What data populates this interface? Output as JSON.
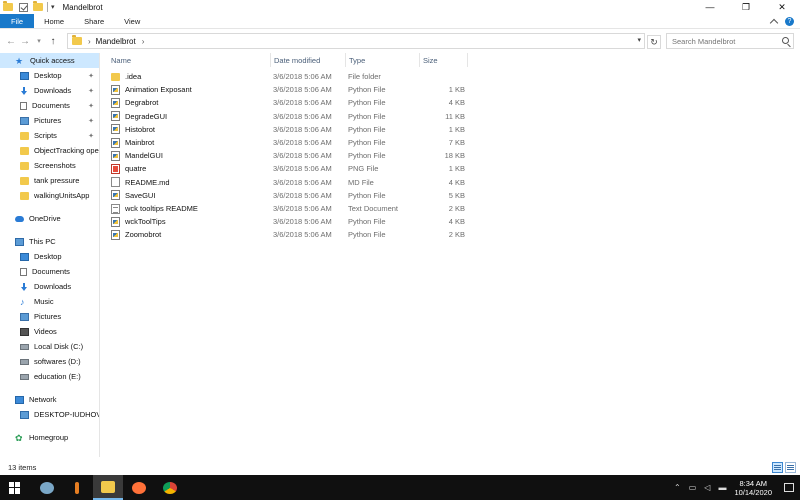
{
  "window": {
    "title": "Mandelbrot",
    "controls": {
      "minimize": "—",
      "maximize": "❐",
      "close": "✕"
    }
  },
  "ribbon": {
    "tabs": [
      "File",
      "Home",
      "Share",
      "View"
    ],
    "help": "?"
  },
  "address_bar": {
    "path": "Mandelbrot",
    "search_placeholder": "Search Mandelbrot"
  },
  "sidebar": {
    "quick_access": {
      "label": "Quick access",
      "items": [
        {
          "label": "Desktop",
          "icon": "desktop-icon",
          "pinned": true
        },
        {
          "label": "Downloads",
          "icon": "download-icon",
          "pinned": true
        },
        {
          "label": "Documents",
          "icon": "documents-icon",
          "pinned": true
        },
        {
          "label": "Pictures",
          "icon": "pictures-icon",
          "pinned": true
        },
        {
          "label": "Scripts",
          "icon": "folder-icon",
          "pinned": true
        },
        {
          "label": "ObjectTracking ope",
          "icon": "folder-icon",
          "pinned": false
        },
        {
          "label": "Screenshots",
          "icon": "folder-icon",
          "pinned": false
        },
        {
          "label": "tank pressure",
          "icon": "folder-icon",
          "pinned": false
        },
        {
          "label": "walkingUnitsApp",
          "icon": "folder-icon",
          "pinned": false
        }
      ]
    },
    "onedrive": "OneDrive",
    "this_pc": {
      "label": "This PC",
      "items": [
        {
          "label": "Desktop",
          "icon": "desktop-icon"
        },
        {
          "label": "Documents",
          "icon": "documents-icon"
        },
        {
          "label": "Downloads",
          "icon": "download-icon"
        },
        {
          "label": "Music",
          "icon": "music-icon"
        },
        {
          "label": "Pictures",
          "icon": "pictures-icon"
        },
        {
          "label": "Videos",
          "icon": "videos-icon"
        },
        {
          "label": "Local Disk (C:)",
          "icon": "disk-icon"
        },
        {
          "label": "softwares (D:)",
          "icon": "disk-icon"
        },
        {
          "label": "education (E:)",
          "icon": "disk-icon"
        }
      ]
    },
    "network": {
      "label": "Network",
      "items": [
        {
          "label": "DESKTOP-IUDHOVL",
          "icon": "computer-icon"
        }
      ]
    },
    "homegroup": "Homegroup"
  },
  "file_list": {
    "columns": [
      "Name",
      "Date modified",
      "Type",
      "Size"
    ],
    "rows": [
      {
        "name": ".idea",
        "date": "3/6/2018 5:06 AM",
        "type": "File folder",
        "size": "",
        "icon": "folder"
      },
      {
        "name": "Animation Exposant",
        "date": "3/6/2018 5:06 AM",
        "type": "Python File",
        "size": "1 KB",
        "icon": "py"
      },
      {
        "name": "Degrabrot",
        "date": "3/6/2018 5:06 AM",
        "type": "Python File",
        "size": "4 KB",
        "icon": "py"
      },
      {
        "name": "DegradeGUI",
        "date": "3/6/2018 5:06 AM",
        "type": "Python File",
        "size": "11 KB",
        "icon": "py"
      },
      {
        "name": "Histobrot",
        "date": "3/6/2018 5:06 AM",
        "type": "Python File",
        "size": "1 KB",
        "icon": "py"
      },
      {
        "name": "Mainbrot",
        "date": "3/6/2018 5:06 AM",
        "type": "Python File",
        "size": "7 KB",
        "icon": "py"
      },
      {
        "name": "MandelGUI",
        "date": "3/6/2018 5:06 AM",
        "type": "Python File",
        "size": "18 KB",
        "icon": "py"
      },
      {
        "name": "quatre",
        "date": "3/6/2018 5:06 AM",
        "type": "PNG File",
        "size": "1 KB",
        "icon": "png"
      },
      {
        "name": "README.md",
        "date": "3/6/2018 5:06 AM",
        "type": "MD File",
        "size": "4 KB",
        "icon": "md"
      },
      {
        "name": "SaveGUI",
        "date": "3/6/2018 5:06 AM",
        "type": "Python File",
        "size": "5 KB",
        "icon": "py"
      },
      {
        "name": "wck tooltips README",
        "date": "3/6/2018 5:06 AM",
        "type": "Text Document",
        "size": "2 KB",
        "icon": "txt"
      },
      {
        "name": "wckToolTips",
        "date": "3/6/2018 5:06 AM",
        "type": "Python File",
        "size": "4 KB",
        "icon": "py"
      },
      {
        "name": "Zoomobrot",
        "date": "3/6/2018 5:06 AM",
        "type": "Python File",
        "size": "2 KB",
        "icon": "py"
      }
    ]
  },
  "status_bar": {
    "item_count": "13 items"
  },
  "taskbar": {
    "time": "8:34 AM",
    "date": "10/14/2020",
    "colors": {
      "background": "#101010",
      "accent": "#76b9ed"
    }
  },
  "colors": {
    "file_tab": "#1979ca",
    "selection": "#cde8ff",
    "folder": "#f2c94c"
  }
}
